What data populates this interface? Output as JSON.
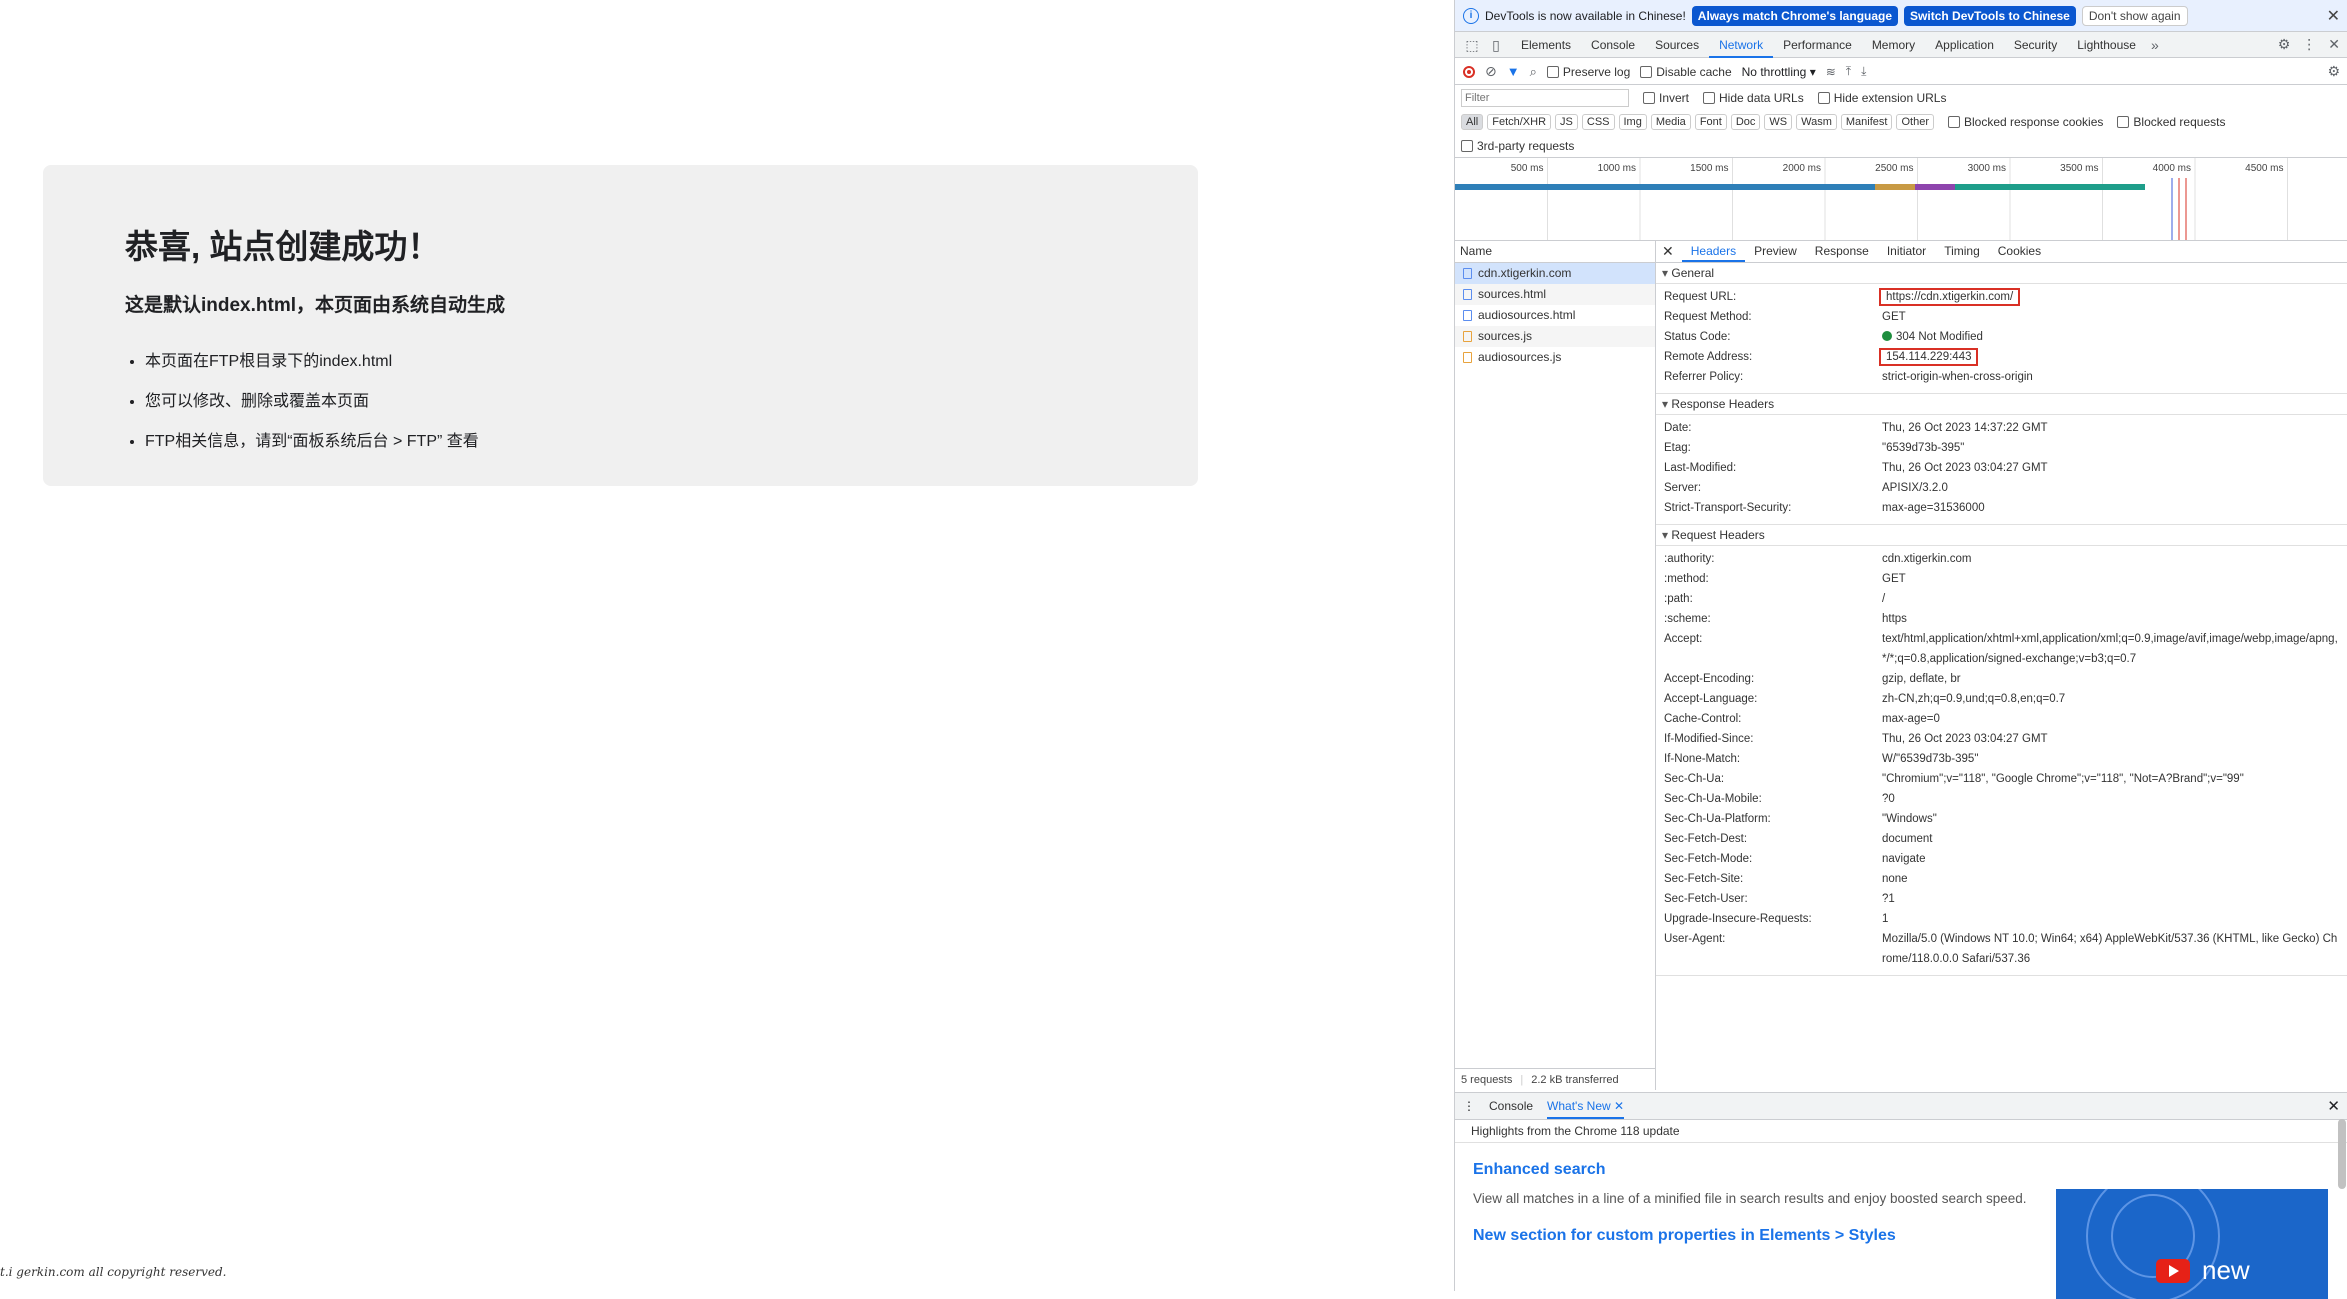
{
  "page": {
    "title": "恭喜, 站点创建成功！",
    "subtitle": "这是默认index.html，本页面由系统自动生成",
    "bullets": [
      "本页面在FTP根目录下的index.html",
      "您可以修改、删除或覆盖本页面",
      "FTP相关信息，请到“面板系统后台 > FTP” 查看"
    ],
    "footer": "t.i gerkin.com all copyright reserved."
  },
  "infobar": {
    "message": "DevTools is now available in Chinese!",
    "btn_match": "Always match Chrome's language",
    "btn_switch": "Switch DevTools to Chinese",
    "btn_dont": "Don't show again"
  },
  "tabs": [
    "Elements",
    "Console",
    "Sources",
    "Network",
    "Performance",
    "Memory",
    "Application",
    "Security",
    "Lighthouse"
  ],
  "toolbar": {
    "preserve_log": "Preserve log",
    "disable_cache": "Disable cache",
    "throttling": "No throttling"
  },
  "filter": {
    "placeholder": "Filter",
    "invert": "Invert",
    "hide_data": "Hide data URLs",
    "hide_ext": "Hide extension URLs",
    "types": [
      "All",
      "Fetch/XHR",
      "JS",
      "CSS",
      "Img",
      "Media",
      "Font",
      "Doc",
      "WS",
      "Wasm",
      "Manifest",
      "Other"
    ],
    "blocked_cookies": "Blocked response cookies",
    "blocked_requests": "Blocked requests",
    "third_party": "3rd-party requests"
  },
  "timeline": {
    "ticks": [
      "500 ms",
      "1000 ms",
      "1500 ms",
      "2000 ms",
      "2500 ms",
      "3000 ms",
      "3500 ms",
      "4000 ms",
      "4500 ms"
    ]
  },
  "requests": {
    "header": "Name",
    "items": [
      {
        "name": "cdn.xtigerkin.com",
        "type": "doc"
      },
      {
        "name": "sources.html",
        "type": "doc"
      },
      {
        "name": "audiosources.html",
        "type": "doc"
      },
      {
        "name": "sources.js",
        "type": "js"
      },
      {
        "name": "audiosources.js",
        "type": "js"
      }
    ]
  },
  "status": {
    "requests": "5 requests",
    "transferred": "2.2 kB transferred"
  },
  "detail_tabs": [
    "Headers",
    "Preview",
    "Response",
    "Initiator",
    "Timing",
    "Cookies"
  ],
  "general": {
    "title": "General",
    "rows": [
      {
        "k": "Request URL:",
        "v": "https://cdn.xtigerkin.com/"
      },
      {
        "k": "Request Method:",
        "v": "GET"
      },
      {
        "k": "Status Code:",
        "v": "304 Not Modified"
      },
      {
        "k": "Remote Address:",
        "v": "154.114.229:443"
      },
      {
        "k": "Referrer Policy:",
        "v": "strict-origin-when-cross-origin"
      }
    ]
  },
  "response_headers": {
    "title": "Response Headers",
    "rows": [
      {
        "k": "Date:",
        "v": "Thu, 26 Oct 2023 14:37:22 GMT"
      },
      {
        "k": "Etag:",
        "v": "\"6539d73b-395\""
      },
      {
        "k": "Last-Modified:",
        "v": "Thu, 26 Oct 2023 03:04:27 GMT"
      },
      {
        "k": "Server:",
        "v": "APISIX/3.2.0"
      },
      {
        "k": "Strict-Transport-Security:",
        "v": "max-age=31536000"
      }
    ]
  },
  "request_headers": {
    "title": "Request Headers",
    "rows": [
      {
        "k": ":authority:",
        "v": "cdn.xtigerkin.com"
      },
      {
        "k": ":method:",
        "v": "GET"
      },
      {
        "k": ":path:",
        "v": "/"
      },
      {
        "k": ":scheme:",
        "v": "https"
      },
      {
        "k": "Accept:",
        "v": "text/html,application/xhtml+xml,application/xml;q=0.9,image/avif,image/webp,image/apng,*/*;q=0.8,application/signed-exchange;v=b3;q=0.7"
      },
      {
        "k": "Accept-Encoding:",
        "v": "gzip, deflate, br"
      },
      {
        "k": "Accept-Language:",
        "v": "zh-CN,zh;q=0.9,und;q=0.8,en;q=0.7"
      },
      {
        "k": "Cache-Control:",
        "v": "max-age=0"
      },
      {
        "k": "If-Modified-Since:",
        "v": "Thu, 26 Oct 2023 03:04:27 GMT"
      },
      {
        "k": "If-None-Match:",
        "v": "W/\"6539d73b-395\""
      },
      {
        "k": "Sec-Ch-Ua:",
        "v": "\"Chromium\";v=\"118\", \"Google Chrome\";v=\"118\", \"Not=A?Brand\";v=\"99\""
      },
      {
        "k": "Sec-Ch-Ua-Mobile:",
        "v": "?0"
      },
      {
        "k": "Sec-Ch-Ua-Platform:",
        "v": "\"Windows\""
      },
      {
        "k": "Sec-Fetch-Dest:",
        "v": "document"
      },
      {
        "k": "Sec-Fetch-Mode:",
        "v": "navigate"
      },
      {
        "k": "Sec-Fetch-Site:",
        "v": "none"
      },
      {
        "k": "Sec-Fetch-User:",
        "v": "?1"
      },
      {
        "k": "Upgrade-Insecure-Requests:",
        "v": "1"
      },
      {
        "k": "User-Agent:",
        "v": "Mozilla/5.0 (Windows NT 10.0; Win64; x64) AppleWebKit/537.36 (KHTML, like Gecko) Chrome/118.0.0.0 Safari/537.36"
      }
    ]
  },
  "drawer": {
    "tabs": [
      "Console",
      "What's New"
    ],
    "highlights": "Highlights from the Chrome 118 update",
    "items": [
      {
        "title": "Enhanced search",
        "body": "View all matches in a line of a minified file in search results and enjoy boosted search speed."
      },
      {
        "title": "New section for custom properties in Elements > Styles",
        "body": ""
      }
    ],
    "video_text": "new"
  },
  "colors": {
    "accent": "#1a73e8",
    "highlight": "#d93025",
    "status_ok": "#1e8e3e"
  }
}
